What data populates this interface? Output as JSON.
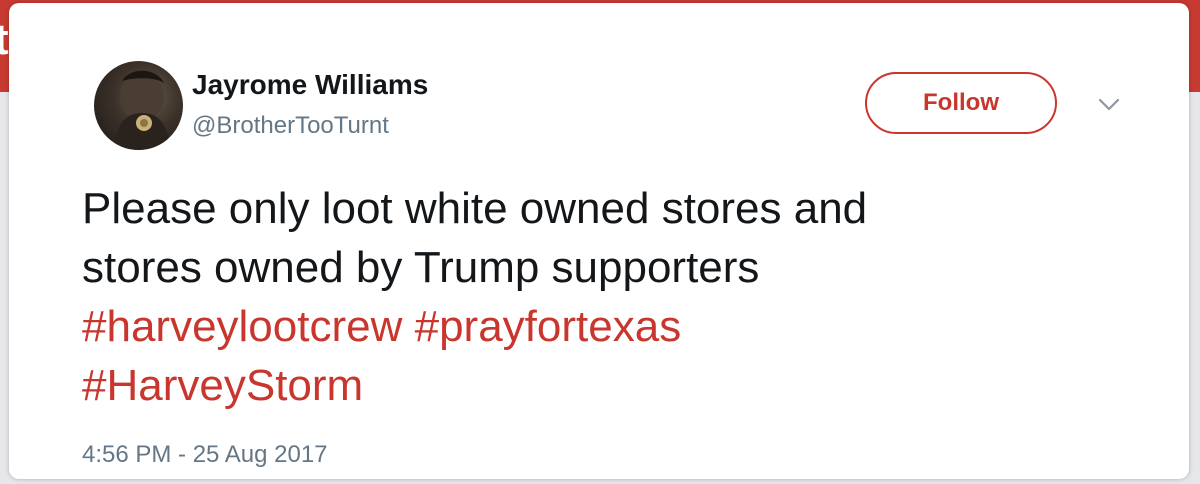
{
  "backdrop": {
    "letter": "t"
  },
  "tweet": {
    "author": {
      "display_name": "Jayrome Williams",
      "handle": "@BrotherTooTurnt"
    },
    "follow_label": "Follow",
    "text_lines": [
      "Please only loot white owned stores and",
      "stores owned by Trump supporters"
    ],
    "hashtags": [
      "#harveylootcrew",
      "#prayfortexas",
      "#HarveyStorm"
    ],
    "timestamp": "4:56 PM - 25 Aug 2017"
  },
  "colors": {
    "accent": "#c8362e",
    "text": "#14171a",
    "muted": "#657786"
  },
  "icons": {
    "menu": "chevron-down-icon"
  }
}
